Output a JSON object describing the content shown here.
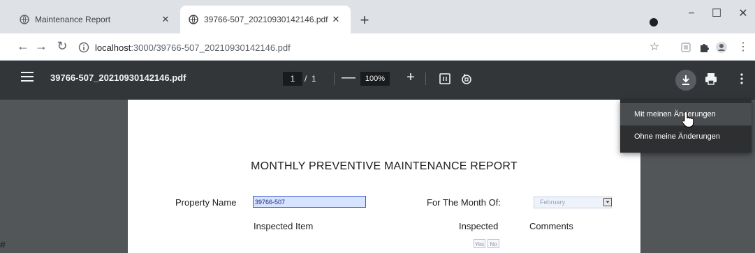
{
  "browser": {
    "tabs": [
      {
        "title": "Maintenance Report",
        "active": false
      },
      {
        "title": "39766-507_20210930142146.pdf",
        "active": true
      }
    ],
    "new_tab": "+",
    "window_controls": {
      "minimize": "−",
      "maximize": "☐",
      "close": "✕"
    },
    "address": {
      "host": "localhost",
      "path": ":3000/39766-507_20210930142146.pdf"
    }
  },
  "pdf_toolbar": {
    "title": "39766-507_20210930142146.pdf",
    "page_current": "1",
    "page_separator": "/",
    "page_total": "1",
    "zoom_out": "—",
    "zoom": "100%",
    "zoom_in": "+"
  },
  "download_menu": {
    "items": [
      "Mit meinen Änderungen",
      "Ohne meine Änderungen"
    ]
  },
  "document": {
    "title": "MONTHLY PREVENTIVE MAINTENANCE REPORT",
    "property_label": "Property Name",
    "property_value": "39766-507",
    "month_label": "For The Month Of:",
    "month_value": "February",
    "col_item": "Inspected Item",
    "col_inspected": "Inspected",
    "col_comments": "Comments",
    "yes": "Yes",
    "no": "No"
  },
  "edge_text": "#",
  "colors": {
    "tabstrip": "#dee1e6",
    "pdf_toolbar": "#323639",
    "viewer_bg": "#525659",
    "field_highlight": "#d6e4ff",
    "field_border": "#3c5bd3"
  }
}
